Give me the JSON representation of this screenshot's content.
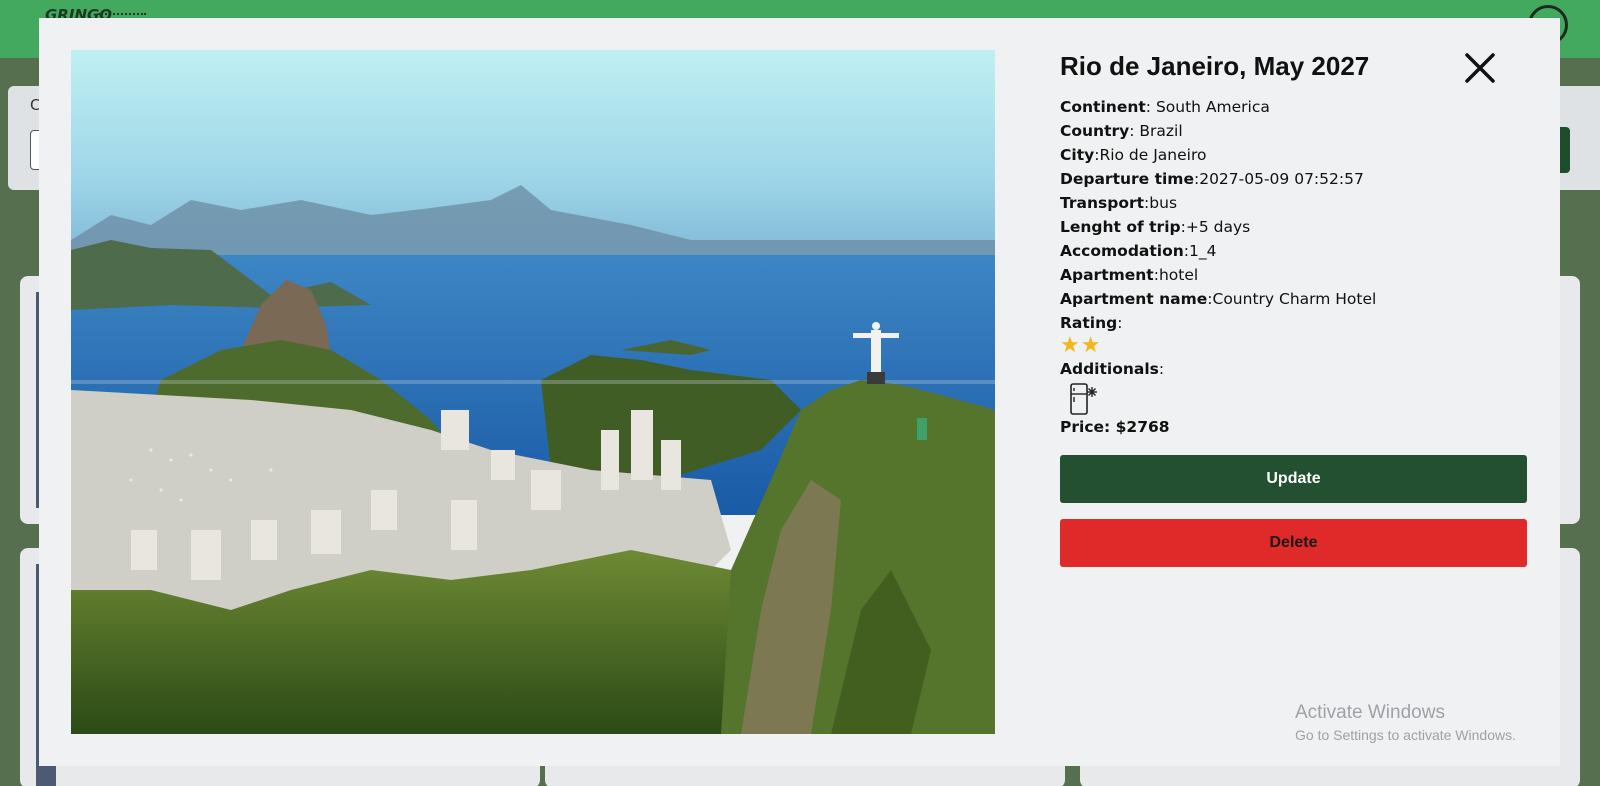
{
  "app": {
    "logo_text": "GRINGO"
  },
  "background": {
    "filter_label": "C"
  },
  "modal": {
    "title": "Rio de Janeiro, May 2027",
    "image_alt": "Rio de Janeiro",
    "details": [
      {
        "label": "Continent",
        "sep": ": ",
        "value": "South America"
      },
      {
        "label": "Country",
        "sep": ": ",
        "value": "Brazil"
      },
      {
        "label": "City",
        "sep": ":",
        "value": "Rio de Janeiro"
      },
      {
        "label": "Departure time",
        "sep": ":",
        "value": "2027-05-09 07:52:57"
      },
      {
        "label": "Transport",
        "sep": ":",
        "value": "bus"
      },
      {
        "label": "Lenght of trip",
        "sep": ":",
        "value": "+5 days"
      },
      {
        "label": "Accomodation",
        "sep": ":",
        "value": "1_4"
      },
      {
        "label": "Apartment",
        "sep": ":",
        "value": "hotel"
      },
      {
        "label": "Apartment name",
        "sep": ":",
        "value": "Country Charm Hotel"
      }
    ],
    "rating": {
      "label": "Rating",
      "sep": ":",
      "stars": "★★",
      "value": 2
    },
    "additionals": {
      "label": "Additionals",
      "sep": ":",
      "icons": [
        "fridge-icon"
      ]
    },
    "price": {
      "label": "Price: ",
      "value": "$2768"
    },
    "update_label": "Update",
    "delete_label": "Delete"
  },
  "watermark": {
    "line1": "Activate Windows",
    "line2": "Go to Settings to activate Windows."
  },
  "colors": {
    "topbar": "#43a95f",
    "update_button": "#225030",
    "delete_button": "#e02a2a",
    "star": "#f3b71a"
  }
}
